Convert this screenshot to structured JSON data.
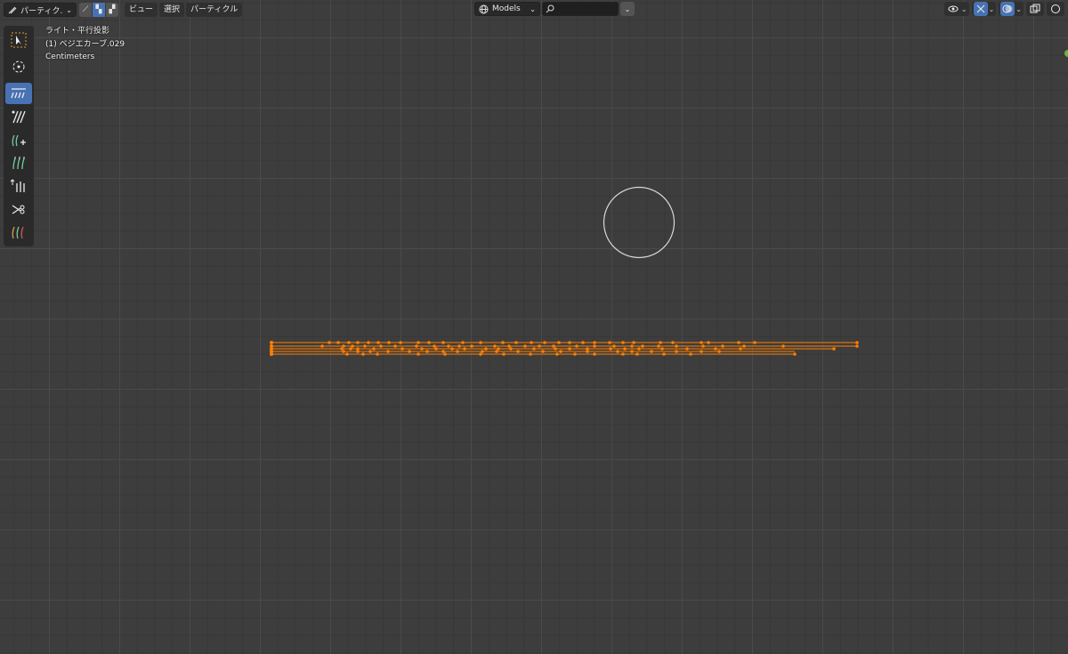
{
  "header": {
    "mode_label": "パーティク...",
    "menu": [
      "ビュー",
      "選択",
      "パーティクル"
    ],
    "scene_selector": "Models",
    "search_placeholder": ""
  },
  "overlay": {
    "view_name": "ライト・平行投影",
    "object_name": "(1) ベジエカーブ.029",
    "units": "Centimeters"
  },
  "toolbar": {
    "tools": [
      "select-box",
      "cursor",
      "comb",
      "smooth",
      "add",
      "length",
      "puff",
      "cut",
      "weight"
    ],
    "active_tool": "comb"
  },
  "colors": {
    "background": "#3d3d3d",
    "accent": "#4772b3",
    "curve": "#ff7f00",
    "brush_circle": "#d9d9d9"
  }
}
